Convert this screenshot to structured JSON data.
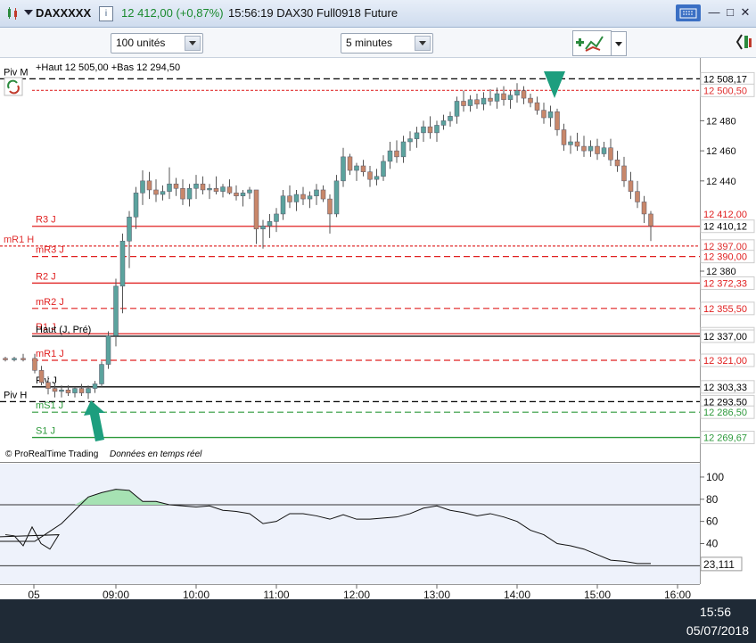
{
  "window": {
    "instrument": "DAXXXXX",
    "price_change": "12 412,00 (+0,87%)",
    "info": "15:56:19 DAX30 Full0918 Future",
    "accent_green": "#1d9e6e"
  },
  "toolbar": {
    "units_value": "100 unités",
    "timeframe_value": "5 minutes"
  },
  "taskbar": {
    "time": "15:56",
    "date": "05/07/2018"
  },
  "chart_data": {
    "type": "candlestick",
    "x_tick_labels": [
      "05",
      "09:00",
      "10:00",
      "11:00",
      "12:00",
      "13:00",
      "14:00",
      "15:00",
      "16:00"
    ],
    "x_ticks_minutes": [
      0,
      540,
      600,
      660,
      720,
      780,
      840,
      900,
      960
    ],
    "y_tick_labels": [
      12480,
      12460,
      12440,
      12380
    ],
    "ylim": [
      12262,
      12517
    ],
    "hilo_text": "+Haut 12 505,00 +Bas 12 294,50",
    "copyright": "© ProRealTime Trading",
    "realtime_note": "Données en temps réel",
    "last_price_label": "12 410,12",
    "last_price_prev_label": "12 412,00",
    "up_color": "#5ba39e",
    "down_color": "#c8876a",
    "levels": [
      {
        "name": "Piv M",
        "label": "12 508,17",
        "value": 12508.17,
        "color": "#000000",
        "style": "dashed",
        "show_name": "left"
      },
      {
        "name": "",
        "label": "12 500,50",
        "value": 12500.5,
        "color": "#e03030",
        "style": "dotted"
      },
      {
        "name": "R3 J",
        "label": "12 410,12",
        "value": 12410.12,
        "color": "#e02020",
        "style": "solid",
        "label_color": "#000000"
      },
      {
        "name": "mR1 H",
        "label": "12 397,00",
        "value": 12397.0,
        "color": "#e03030",
        "style": "dotted",
        "show_name": "left"
      },
      {
        "name": "mR3 J",
        "label": "12 390,00",
        "value": 12390.0,
        "color": "#e02020",
        "style": "dashed"
      },
      {
        "name": "R2 J",
        "label": "12 372,33",
        "value": 12372.33,
        "color": "#e02020",
        "style": "solid"
      },
      {
        "name": "mR2 J",
        "label": "12 355,50",
        "value": 12355.5,
        "color": "#e02020",
        "style": "dashed"
      },
      {
        "name": "R1 J",
        "label": "12 338,67",
        "value": 12338.67,
        "color": "#e02020",
        "style": "solid"
      },
      {
        "name": "Haut (J, Pré)",
        "label": "12 337,00",
        "value": 12337.0,
        "color": "#000000",
        "style": "solid",
        "label_color": "#000000"
      },
      {
        "name": "mR1 J",
        "label": "12 321,00",
        "value": 12321.0,
        "color": "#e02020",
        "style": "dashed"
      },
      {
        "name": "Piv J",
        "label": "12 303,33",
        "value": 12303.33,
        "color": "#000000",
        "style": "solid",
        "label_color": "#000000"
      },
      {
        "name": "Piv H",
        "label": "12 293,50",
        "value": 12293.5,
        "color": "#000000",
        "style": "dashed",
        "show_name": "left",
        "label_color": "#000000"
      },
      {
        "name": "mS1 J",
        "label": "12 286,50",
        "value": 12286.5,
        "color": "#2e9a3c",
        "style": "dashed"
      },
      {
        "name": "S1 J",
        "label": "12 269,67",
        "value": 12269.67,
        "color": "#2e9a3c",
        "style": "solid"
      }
    ],
    "candles": [
      {
        "t": 0,
        "o": 12322,
        "h": 12323,
        "l": 12320,
        "c": 12321
      },
      {
        "t": 10,
        "o": 12321,
        "h": 12323,
        "l": 12320,
        "c": 12322
      },
      {
        "t": 20,
        "o": 12322,
        "h": 12325,
        "l": 12320,
        "c": 12321
      },
      {
        "t": 480,
        "o": 12322,
        "h": 12325,
        "l": 12312,
        "c": 12314
      },
      {
        "t": 485,
        "o": 12314,
        "h": 12317,
        "l": 12304,
        "c": 12306
      },
      {
        "t": 490,
        "o": 12306,
        "h": 12310,
        "l": 12298,
        "c": 12302
      },
      {
        "t": 495,
        "o": 12302,
        "h": 12306,
        "l": 12296,
        "c": 12300
      },
      {
        "t": 500,
        "o": 12300,
        "h": 12304,
        "l": 12296,
        "c": 12301
      },
      {
        "t": 505,
        "o": 12301,
        "h": 12304,
        "l": 12297,
        "c": 12299
      },
      {
        "t": 510,
        "o": 12299,
        "h": 12303,
        "l": 12296,
        "c": 12302
      },
      {
        "t": 515,
        "o": 12302,
        "h": 12305,
        "l": 12297,
        "c": 12299
      },
      {
        "t": 520,
        "o": 12299,
        "h": 12304,
        "l": 12295,
        "c": 12302
      },
      {
        "t": 525,
        "o": 12302,
        "h": 12307,
        "l": 12299,
        "c": 12305
      },
      {
        "t": 530,
        "o": 12305,
        "h": 12320,
        "l": 12303,
        "c": 12318
      },
      {
        "t": 535,
        "o": 12318,
        "h": 12340,
        "l": 12315,
        "c": 12337
      },
      {
        "t": 540,
        "o": 12337,
        "h": 12375,
        "l": 12330,
        "c": 12370
      },
      {
        "t": 545,
        "o": 12370,
        "h": 12405,
        "l": 12352,
        "c": 12400
      },
      {
        "t": 550,
        "o": 12400,
        "h": 12420,
        "l": 12382,
        "c": 12416
      },
      {
        "t": 555,
        "o": 12416,
        "h": 12436,
        "l": 12408,
        "c": 12432
      },
      {
        "t": 560,
        "o": 12432,
        "h": 12447,
        "l": 12424,
        "c": 12440
      },
      {
        "t": 565,
        "o": 12440,
        "h": 12446,
        "l": 12428,
        "c": 12434
      },
      {
        "t": 570,
        "o": 12434,
        "h": 12441,
        "l": 12426,
        "c": 12431
      },
      {
        "t": 575,
        "o": 12431,
        "h": 12437,
        "l": 12427,
        "c": 12433
      },
      {
        "t": 580,
        "o": 12433,
        "h": 12449,
        "l": 12428,
        "c": 12438
      },
      {
        "t": 585,
        "o": 12438,
        "h": 12442,
        "l": 12430,
        "c": 12435
      },
      {
        "t": 590,
        "o": 12435,
        "h": 12441,
        "l": 12424,
        "c": 12428
      },
      {
        "t": 595,
        "o": 12428,
        "h": 12438,
        "l": 12423,
        "c": 12435
      },
      {
        "t": 600,
        "o": 12435,
        "h": 12444,
        "l": 12428,
        "c": 12438
      },
      {
        "t": 605,
        "o": 12438,
        "h": 12443,
        "l": 12431,
        "c": 12434
      },
      {
        "t": 610,
        "o": 12434,
        "h": 12438,
        "l": 12428,
        "c": 12435
      },
      {
        "t": 615,
        "o": 12435,
        "h": 12443,
        "l": 12431,
        "c": 12433
      },
      {
        "t": 620,
        "o": 12433,
        "h": 12438,
        "l": 12429,
        "c": 12436
      },
      {
        "t": 625,
        "o": 12436,
        "h": 12441,
        "l": 12431,
        "c": 12432
      },
      {
        "t": 630,
        "o": 12432,
        "h": 12437,
        "l": 12427,
        "c": 12430
      },
      {
        "t": 635,
        "o": 12430,
        "h": 12434,
        "l": 12423,
        "c": 12432
      },
      {
        "t": 640,
        "o": 12432,
        "h": 12436,
        "l": 12428,
        "c": 12434
      },
      {
        "t": 645,
        "o": 12434,
        "h": 12434,
        "l": 12398,
        "c": 12408
      },
      {
        "t": 650,
        "o": 12408,
        "h": 12414,
        "l": 12395,
        "c": 12410
      },
      {
        "t": 655,
        "o": 12410,
        "h": 12418,
        "l": 12402,
        "c": 12413
      },
      {
        "t": 660,
        "o": 12413,
        "h": 12422,
        "l": 12406,
        "c": 12418
      },
      {
        "t": 665,
        "o": 12418,
        "h": 12434,
        "l": 12414,
        "c": 12430
      },
      {
        "t": 670,
        "o": 12430,
        "h": 12437,
        "l": 12422,
        "c": 12426
      },
      {
        "t": 675,
        "o": 12426,
        "h": 12434,
        "l": 12420,
        "c": 12431
      },
      {
        "t": 680,
        "o": 12431,
        "h": 12436,
        "l": 12424,
        "c": 12428
      },
      {
        "t": 685,
        "o": 12428,
        "h": 12433,
        "l": 12422,
        "c": 12430
      },
      {
        "t": 690,
        "o": 12430,
        "h": 12438,
        "l": 12424,
        "c": 12434
      },
      {
        "t": 695,
        "o": 12434,
        "h": 12437,
        "l": 12426,
        "c": 12428
      },
      {
        "t": 700,
        "o": 12428,
        "h": 12431,
        "l": 12405,
        "c": 12418
      },
      {
        "t": 705,
        "o": 12418,
        "h": 12444,
        "l": 12416,
        "c": 12440
      },
      {
        "t": 710,
        "o": 12440,
        "h": 12462,
        "l": 12436,
        "c": 12456
      },
      {
        "t": 715,
        "o": 12456,
        "h": 12458,
        "l": 12444,
        "c": 12447
      },
      {
        "t": 720,
        "o": 12447,
        "h": 12452,
        "l": 12440,
        "c": 12450
      },
      {
        "t": 725,
        "o": 12450,
        "h": 12454,
        "l": 12443,
        "c": 12446
      },
      {
        "t": 730,
        "o": 12446,
        "h": 12450,
        "l": 12436,
        "c": 12441
      },
      {
        "t": 735,
        "o": 12441,
        "h": 12448,
        "l": 12437,
        "c": 12443
      },
      {
        "t": 740,
        "o": 12443,
        "h": 12457,
        "l": 12440,
        "c": 12453
      },
      {
        "t": 745,
        "o": 12453,
        "h": 12466,
        "l": 12448,
        "c": 12460
      },
      {
        "t": 750,
        "o": 12460,
        "h": 12467,
        "l": 12452,
        "c": 12456
      },
      {
        "t": 755,
        "o": 12456,
        "h": 12470,
        "l": 12452,
        "c": 12466
      },
      {
        "t": 760,
        "o": 12466,
        "h": 12473,
        "l": 12460,
        "c": 12468
      },
      {
        "t": 765,
        "o": 12468,
        "h": 12476,
        "l": 12462,
        "c": 12472
      },
      {
        "t": 770,
        "o": 12472,
        "h": 12480,
        "l": 12466,
        "c": 12476
      },
      {
        "t": 775,
        "o": 12476,
        "h": 12483,
        "l": 12468,
        "c": 12472
      },
      {
        "t": 780,
        "o": 12472,
        "h": 12480,
        "l": 12466,
        "c": 12477
      },
      {
        "t": 785,
        "o": 12477,
        "h": 12484,
        "l": 12474,
        "c": 12480
      },
      {
        "t": 790,
        "o": 12480,
        "h": 12486,
        "l": 12476,
        "c": 12483
      },
      {
        "t": 795,
        "o": 12483,
        "h": 12496,
        "l": 12478,
        "c": 12493
      },
      {
        "t": 800,
        "o": 12493,
        "h": 12500,
        "l": 12486,
        "c": 12490
      },
      {
        "t": 805,
        "o": 12490,
        "h": 12497,
        "l": 12486,
        "c": 12494
      },
      {
        "t": 810,
        "o": 12494,
        "h": 12498,
        "l": 12488,
        "c": 12491
      },
      {
        "t": 815,
        "o": 12491,
        "h": 12499,
        "l": 12487,
        "c": 12495
      },
      {
        "t": 820,
        "o": 12495,
        "h": 12501,
        "l": 12490,
        "c": 12493
      },
      {
        "t": 825,
        "o": 12493,
        "h": 12502,
        "l": 12488,
        "c": 12498
      },
      {
        "t": 830,
        "o": 12498,
        "h": 12503,
        "l": 12490,
        "c": 12494
      },
      {
        "t": 835,
        "o": 12494,
        "h": 12500,
        "l": 12488,
        "c": 12497
      },
      {
        "t": 840,
        "o": 12497,
        "h": 12505,
        "l": 12492,
        "c": 12500
      },
      {
        "t": 845,
        "o": 12500,
        "h": 12503,
        "l": 12491,
        "c": 12495
      },
      {
        "t": 850,
        "o": 12495,
        "h": 12498,
        "l": 12489,
        "c": 12492
      },
      {
        "t": 855,
        "o": 12492,
        "h": 12496,
        "l": 12484,
        "c": 12487
      },
      {
        "t": 860,
        "o": 12487,
        "h": 12492,
        "l": 12478,
        "c": 12482
      },
      {
        "t": 865,
        "o": 12482,
        "h": 12490,
        "l": 12476,
        "c": 12486
      },
      {
        "t": 870,
        "o": 12486,
        "h": 12488,
        "l": 12470,
        "c": 12474
      },
      {
        "t": 875,
        "o": 12474,
        "h": 12478,
        "l": 12460,
        "c": 12464
      },
      {
        "t": 880,
        "o": 12464,
        "h": 12470,
        "l": 12458,
        "c": 12466
      },
      {
        "t": 885,
        "o": 12466,
        "h": 12472,
        "l": 12460,
        "c": 12463
      },
      {
        "t": 890,
        "o": 12463,
        "h": 12470,
        "l": 12456,
        "c": 12460
      },
      {
        "t": 895,
        "o": 12460,
        "h": 12467,
        "l": 12456,
        "c": 12463
      },
      {
        "t": 900,
        "o": 12463,
        "h": 12468,
        "l": 12454,
        "c": 12458
      },
      {
        "t": 905,
        "o": 12458,
        "h": 12466,
        "l": 12456,
        "c": 12462
      },
      {
        "t": 910,
        "o": 12462,
        "h": 12468,
        "l": 12450,
        "c": 12454
      },
      {
        "t": 915,
        "o": 12454,
        "h": 12460,
        "l": 12446,
        "c": 12450
      },
      {
        "t": 920,
        "o": 12450,
        "h": 12456,
        "l": 12436,
        "c": 12440
      },
      {
        "t": 925,
        "o": 12440,
        "h": 12446,
        "l": 12428,
        "c": 12433
      },
      {
        "t": 930,
        "o": 12433,
        "h": 12440,
        "l": 12422,
        "c": 12426
      },
      {
        "t": 935,
        "o": 12426,
        "h": 12430,
        "l": 12412,
        "c": 12418
      },
      {
        "t": 940,
        "o": 12418,
        "h": 12420,
        "l": 12400,
        "c": 12410
      }
    ],
    "oscillator": {
      "ticks": [
        100,
        80,
        60,
        40
      ],
      "ylim": [
        5,
        108
      ],
      "upper_band": 75,
      "lower_band": 20,
      "last_label": "23,111",
      "t": [
        0,
        10,
        20,
        30,
        40,
        50,
        60,
        70,
        80,
        90,
        100,
        110,
        480,
        490,
        500,
        510,
        520,
        530,
        540,
        550,
        560,
        570,
        580,
        590,
        600,
        610,
        620,
        630,
        640,
        650,
        660,
        670,
        680,
        690,
        700,
        710,
        720,
        730,
        740,
        750,
        760,
        770,
        780,
        790,
        800,
        810,
        820,
        830,
        840,
        850,
        860,
        870,
        880,
        890,
        900,
        910,
        920,
        930,
        940
      ],
      "values": [
        48,
        47,
        38,
        55,
        40,
        35,
        48,
        30,
        28,
        28,
        32,
        42,
        42,
        50,
        58,
        70,
        82,
        86,
        89,
        88,
        78,
        78,
        75,
        74,
        73,
        74,
        70,
        69,
        67,
        58,
        60,
        67,
        67,
        65,
        62,
        66,
        62,
        62,
        63,
        64,
        67,
        72,
        74,
        70,
        68,
        65,
        67,
        64,
        60,
        52,
        48,
        40,
        38,
        35,
        30,
        25,
        24,
        22,
        22
      ]
    }
  }
}
